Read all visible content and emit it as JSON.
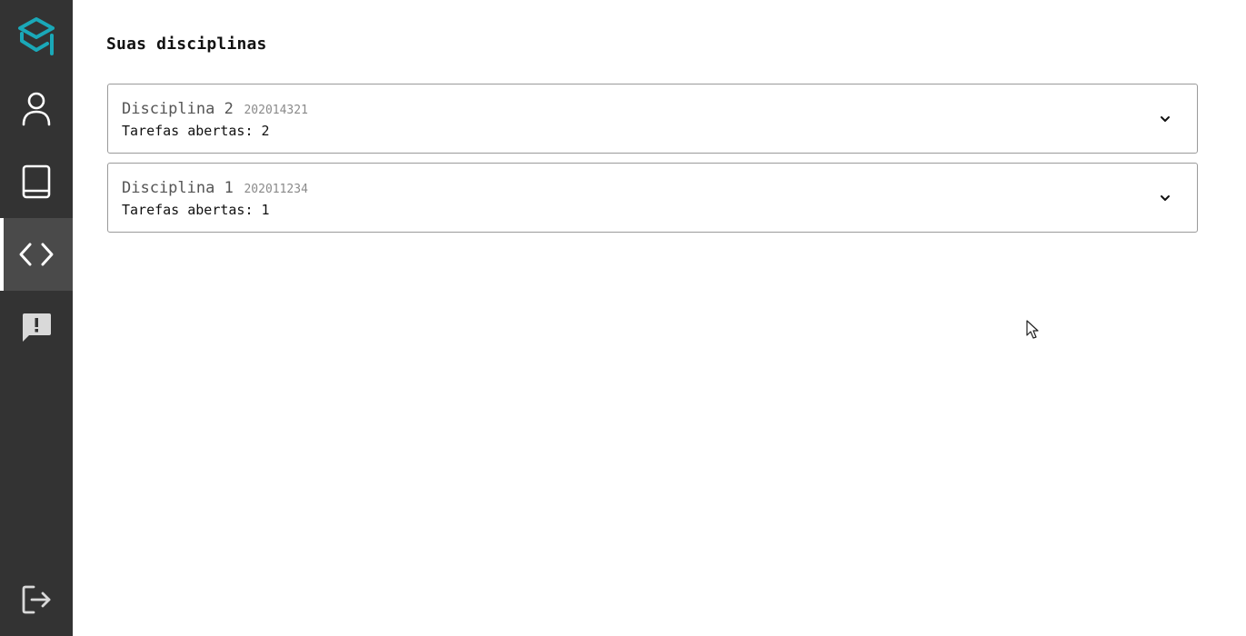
{
  "sidebar": {
    "logo_name": "app-logo",
    "items": [
      {
        "icon": "user-icon",
        "active": false
      },
      {
        "icon": "book-icon",
        "active": false
      },
      {
        "icon": "code-icon",
        "active": true
      },
      {
        "icon": "feedback-icon",
        "active": false
      }
    ],
    "logout_icon": "logout-icon"
  },
  "main": {
    "title": "Suas disciplinas",
    "courses": [
      {
        "name": "Disciplina 2",
        "code": "202014321",
        "tasks": "Tarefas abertas: 2"
      },
      {
        "name": "Disciplina 1",
        "code": "202011234",
        "tasks": "Tarefas abertas: 1"
      }
    ]
  },
  "colors": {
    "sidebar_bg": "#333333",
    "sidebar_active_bg": "#4a4a4a",
    "accent": "#1aa8b8",
    "icon": "#ffffff"
  }
}
